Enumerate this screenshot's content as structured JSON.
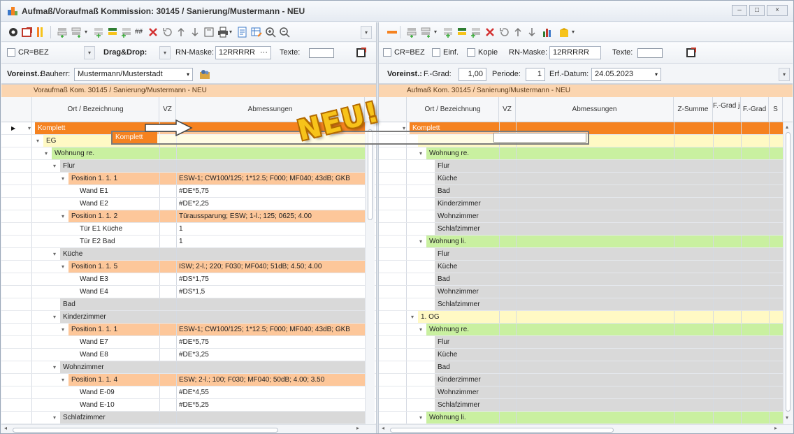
{
  "window": {
    "title": "Aufmaß/Voraufmaß Kommission: 30145 / Sanierung/Mustermann - NEU",
    "min": "–",
    "max": "□",
    "close": "×"
  },
  "left": {
    "toolbar2": {
      "crbez": "CR=BEZ",
      "dragdrop": "Drag&Drop:",
      "rnmask_label": "RN-Maske:",
      "rnmask_value": "12RRRRR",
      "rnmask_btn": "···",
      "texte_label": "Texte:"
    },
    "toolbar3": {
      "voreinst": "Voreinst.:",
      "bauherr_label": "Bauherr:",
      "bauherr_value": "Mustermann/Musterstadt"
    },
    "band": "Voraufmaß Kom. 30145 / Sanierung/Mustermann - NEU",
    "headers": [
      "Ort / Bezeichnung",
      "VZ",
      "Abmessungen"
    ],
    "rows": [
      {
        "name": "Komplett",
        "vz": "",
        "dims": "",
        "style": "orange",
        "level": 0,
        "expander": "▾",
        "current": true
      },
      {
        "name": "EG",
        "vz": "",
        "dims": "",
        "style": "yellow",
        "level": 1,
        "expander": "▾"
      },
      {
        "name": "Wohnung re.",
        "vz": "",
        "dims": "",
        "style": "green",
        "level": 2,
        "expander": "▾"
      },
      {
        "name": "Flur",
        "vz": "",
        "dims": "",
        "style": "gray",
        "level": 3,
        "expander": "▾"
      },
      {
        "name": "Position  1. 1.  1",
        "vz": "",
        "dims": "ESW-1; CW100/125; 1*12.5; F000; MF040; 43dB; GKB",
        "style": "peach",
        "level": 4,
        "expander": "▾"
      },
      {
        "name": "Wand E1",
        "vz": "",
        "dims": "#DE*5,75",
        "style": "white",
        "level": 5
      },
      {
        "name": "Wand E2",
        "vz": "",
        "dims": "#DE*2,25",
        "style": "white",
        "level": 5
      },
      {
        "name": "Position  1. 1.  2",
        "vz": "",
        "dims": "Türaussparung; ESW; 1-l.; 125; 0625; 4.00",
        "style": "peach",
        "level": 4,
        "expander": "▾"
      },
      {
        "name": "Tür E1 Küche",
        "vz": "",
        "dims": "1",
        "style": "white",
        "level": 5
      },
      {
        "name": "Tür E2 Bad",
        "vz": "",
        "dims": "1",
        "style": "white",
        "level": 5
      },
      {
        "name": "Küche",
        "vz": "",
        "dims": "",
        "style": "gray",
        "level": 3,
        "expander": "▾"
      },
      {
        "name": "Position  1. 1.  5",
        "vz": "",
        "dims": "ISW; 2-l.; 220; F030; MF040; 51dB; 4.50; 4.00",
        "style": "peach",
        "level": 4,
        "expander": "▾"
      },
      {
        "name": "Wand E3",
        "vz": "",
        "dims": "#DS*1,75",
        "style": "white",
        "level": 5
      },
      {
        "name": "Wand E4",
        "vz": "",
        "dims": "#DS*1,5",
        "style": "white",
        "level": 5
      },
      {
        "name": "Bad",
        "vz": "",
        "dims": "",
        "style": "gray",
        "level": 3
      },
      {
        "name": "Kinderzimmer",
        "vz": "",
        "dims": "",
        "style": "gray",
        "level": 3,
        "expander": "▾"
      },
      {
        "name": "Position  1. 1.  1",
        "vz": "",
        "dims": "ESW-1; CW100/125; 1*12.5; F000; MF040; 43dB; GKB",
        "style": "peach",
        "level": 4,
        "expander": "▾"
      },
      {
        "name": "Wand E7",
        "vz": "",
        "dims": "#DE*5,75",
        "style": "white",
        "level": 5
      },
      {
        "name": "Wand E8",
        "vz": "",
        "dims": "#DE*3,25",
        "style": "white",
        "level": 5
      },
      {
        "name": "Wohnzimmer",
        "vz": "",
        "dims": "",
        "style": "gray",
        "level": 3,
        "expander": "▾"
      },
      {
        "name": "Position  1. 1.  4",
        "vz": "",
        "dims": "ESW; 2-l.; 100; F030; MF040; 50dB; 4.00; 3.50",
        "style": "peach",
        "level": 4,
        "expander": "▾"
      },
      {
        "name": "Wand E-09",
        "vz": "",
        "dims": "#DE*4,55",
        "style": "white",
        "level": 5
      },
      {
        "name": "Wand E-10",
        "vz": "",
        "dims": "#DE*5,25",
        "style": "white",
        "level": 5
      },
      {
        "name": "Schlafzimmer",
        "vz": "",
        "dims": "",
        "style": "gray",
        "level": 3,
        "expander": "▾"
      }
    ]
  },
  "right": {
    "toolbar2": {
      "crbez": "CR=BEZ",
      "einf": "Einf.",
      "kopie": "Kopie",
      "rnmask_label": "RN-Maske:",
      "rnmask_value": "12RRRRR",
      "texte_label": "Texte:"
    },
    "toolbar3": {
      "voreinst": "Voreinst.:",
      "fgrad_label": "F.-Grad:",
      "fgrad_value": "1,00",
      "periode_label": "Periode:",
      "periode_value": "1",
      "erf_label": "Erf.-Datum:",
      "erf_value": "24.05.2023"
    },
    "band": "Aufmaß Kom. 30145 / Sanierung/Mustermann - NEU",
    "headers": [
      "Ort / Bezeichnung",
      "VZ",
      "Abmessungen",
      "Z-Summe",
      "F.-Grad je Zeile",
      "F.-Grad",
      "S"
    ],
    "rows": [
      {
        "name": "Komplett",
        "style": "orange",
        "level": 0,
        "expander": "▾"
      },
      {
        "name": "",
        "style": "yellow",
        "level": 1
      },
      {
        "name": "Wohnung re.",
        "style": "green",
        "level": 2,
        "expander": "▾"
      },
      {
        "name": "Flur",
        "style": "gray",
        "level": 3
      },
      {
        "name": "Küche",
        "style": "gray",
        "level": 3
      },
      {
        "name": "Bad",
        "style": "gray",
        "level": 3
      },
      {
        "name": "Kinderzimmer",
        "style": "gray",
        "level": 3
      },
      {
        "name": "Wohnzimmer",
        "style": "gray",
        "level": 3
      },
      {
        "name": "Schlafzimmer",
        "style": "gray",
        "level": 3
      },
      {
        "name": "Wohnung li.",
        "style": "green",
        "level": 2,
        "expander": "▾"
      },
      {
        "name": "Flur",
        "style": "gray",
        "level": 3
      },
      {
        "name": "Küche",
        "style": "gray",
        "level": 3
      },
      {
        "name": "Bad",
        "style": "gray",
        "level": 3
      },
      {
        "name": "Wohnzimmer",
        "style": "gray",
        "level": 3
      },
      {
        "name": "Schlafzimmer",
        "style": "gray",
        "level": 3
      },
      {
        "name": "1. OG",
        "style": "yellow",
        "level": 1,
        "expander": "▾"
      },
      {
        "name": "Wohnung re.",
        "style": "green",
        "level": 2,
        "expander": "▾"
      },
      {
        "name": "Flur",
        "style": "gray",
        "level": 3
      },
      {
        "name": "Küche",
        "style": "gray",
        "level": 3
      },
      {
        "name": "Bad",
        "style": "gray",
        "level": 3
      },
      {
        "name": "Kinderzimmer",
        "style": "gray",
        "level": 3
      },
      {
        "name": "Wohnzimmer",
        "style": "gray",
        "level": 3
      },
      {
        "name": "Schlafzimmer",
        "style": "gray",
        "level": 3
      },
      {
        "name": "Wohnung li.",
        "style": "green",
        "level": 2,
        "expander": "▾"
      }
    ]
  },
  "drag": {
    "label": "Komplett",
    "badge": "NEU!"
  },
  "colors": {
    "orange": "#f58220",
    "yellow": "#fff9c4",
    "green": "#c9f0a0",
    "gray": "#d9d9d9",
    "peach": "#fdc79a",
    "white": "#ffffff"
  }
}
